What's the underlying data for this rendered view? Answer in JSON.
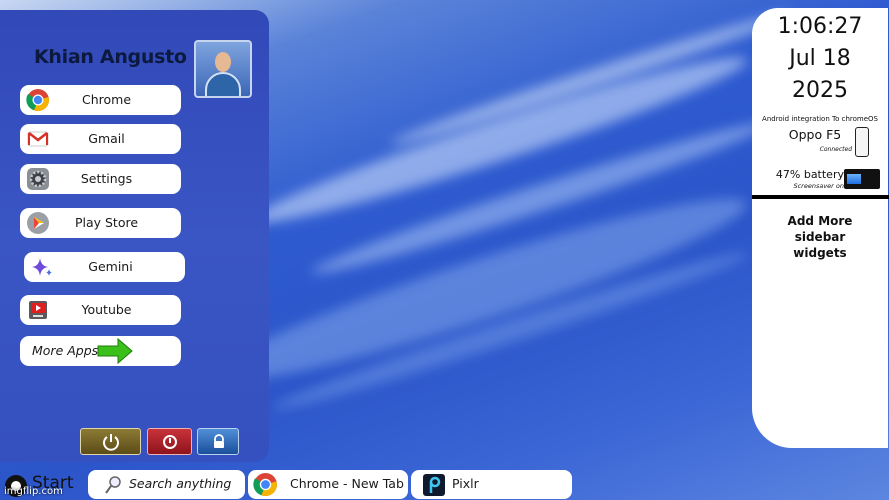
{
  "user": {
    "name": "Khian Angusto"
  },
  "apps": [
    {
      "label": "Chrome",
      "icon": "chrome-icon"
    },
    {
      "label": "Gmail",
      "icon": "gmail-icon"
    },
    {
      "label": "Settings",
      "icon": "settings-gear-icon"
    },
    {
      "label": "Play Store",
      "icon": "play-store-icon"
    },
    {
      "label": "Gemini",
      "icon": "gemini-sparkle-icon"
    },
    {
      "label": "Youtube",
      "icon": "youtube-icon"
    }
  ],
  "more_apps": {
    "label": "More Apps",
    "icon": "green-arrow-icon"
  },
  "power": {
    "power_icon": "power-icon",
    "shutdown_icon": "shutdown-icon",
    "lock_icon": "lock-icon"
  },
  "sidebar": {
    "time": "1:06:27",
    "date": "Jul 18",
    "year": "2025",
    "android_caption": "Android integration To chromeOS",
    "phone_name": "Oppo F5",
    "phone_status": "Connected",
    "battery_text": "47% battery",
    "battery_level": 0.47,
    "screensaver": "Screensaver on",
    "add_widgets": "Add More sidebar widgets"
  },
  "taskbar": {
    "start_label": "Start",
    "search_placeholder": "Search anything",
    "items": [
      {
        "label": "Chrome - New Tab",
        "icon": "chrome-icon"
      },
      {
        "label": "Pixlr",
        "icon": "pixlr-icon"
      }
    ]
  },
  "watermark": "imgflip.com",
  "colors": {
    "accent_blue": "#3550bf",
    "shutdown_red": "#b5212a",
    "power_olive": "#6e5e24"
  }
}
